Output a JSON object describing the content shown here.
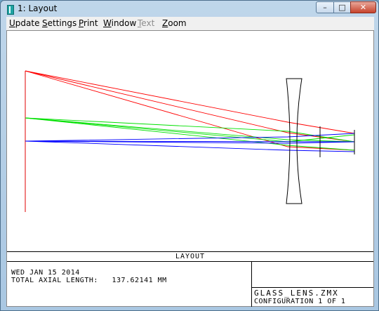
{
  "window": {
    "title": "1: Layout",
    "minimize_glyph": "–",
    "maximize_glyph": "□",
    "close_glyph": "✕"
  },
  "menu": {
    "items": [
      {
        "prefix": "",
        "mnemonic": "U",
        "suffix": "pdate",
        "enabled": true
      },
      {
        "prefix": "",
        "mnemonic": "S",
        "suffix": "ettings",
        "enabled": true
      },
      {
        "prefix": "",
        "mnemonic": "P",
        "suffix": "rint",
        "enabled": true
      },
      {
        "prefix": "",
        "mnemonic": "W",
        "suffix": "indow",
        "enabled": true
      },
      {
        "prefix": "",
        "mnemonic": "T",
        "suffix": "ext",
        "enabled": false
      },
      {
        "prefix": "",
        "mnemonic": "Z",
        "suffix": "oom",
        "enabled": true
      }
    ]
  },
  "layout": {
    "title": "LAYOUT",
    "date": "WED JAN 15 2014",
    "axial_length_label": "TOTAL AXIAL LENGTH:",
    "axial_length_value": "137.62141 MM",
    "file_name": "GLASS_LENS.ZMX",
    "configuration": "CONFIGURATION 1 OF 1"
  },
  "colors": {
    "ray_field_1": "#0000ff",
    "ray_field_2": "#00e000",
    "ray_field_3": "#ff0000",
    "lens_outline": "#000000",
    "object_plane": "#e00000"
  }
}
